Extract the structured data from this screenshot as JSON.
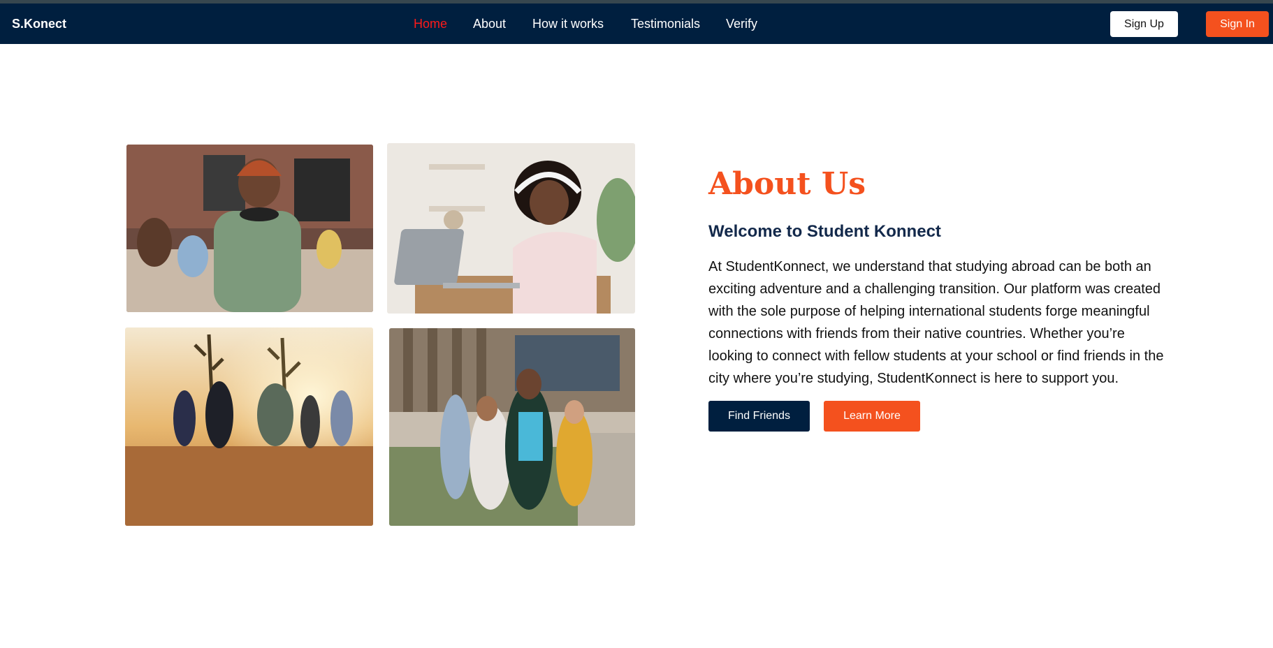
{
  "nav": {
    "brand": "S.Konect",
    "links": [
      {
        "label": "Home",
        "active": true
      },
      {
        "label": "About",
        "active": false
      },
      {
        "label": "How it works",
        "active": false
      },
      {
        "label": "Testimonials",
        "active": false
      },
      {
        "label": "Verify",
        "active": false
      }
    ],
    "signup_label": "Sign Up",
    "signin_label": "Sign In"
  },
  "gallery": {
    "photos": [
      {
        "subject": "student-with-beanie-and-headphones"
      },
      {
        "subject": "student-studying-on-laptop"
      },
      {
        "subject": "friends-running-in-desert-sunset"
      },
      {
        "subject": "group-of-students-outside-campus"
      }
    ]
  },
  "about": {
    "title": "About Us",
    "subtitle": "Welcome to Student Konnect",
    "body": "At StudentKonnect, we understand that studying abroad can be both an exciting adventure and a challenging transition. Our platform was created with the sole purpose of helping international students forge meaningful connections with friends from their native countries. Whether you’re looking to connect with fellow students at your school or find friends in the city where you’re studying, StudentKonnect is here to support you.",
    "find_friends_label": "Find Friends",
    "learn_more_label": "Learn More"
  },
  "colors": {
    "navbar": "#001f3f",
    "accent": "#f4511e",
    "active_link": "#ff1a1a",
    "subtitle": "#13294b"
  }
}
